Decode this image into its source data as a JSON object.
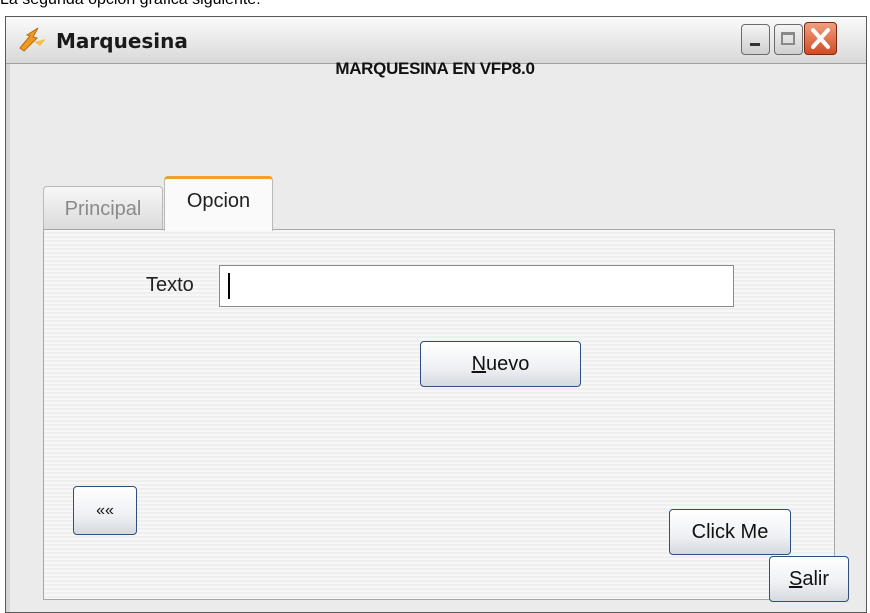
{
  "caption": "La segunda opcion grafica siguiente:",
  "window": {
    "title": "Marquesina",
    "minimize_icon": "minimize-icon",
    "maximize_icon": "maximize-icon",
    "close_icon": "close-icon",
    "app_icon": "lightning-fox-icon"
  },
  "form": {
    "heading": "MARQUESINA EN VFP8.0",
    "tabs": [
      {
        "label": "Principal",
        "active": false
      },
      {
        "label": "Opcion",
        "active": true
      }
    ],
    "texto_label": "Texto",
    "texto_value": "",
    "nuevo_first": "N",
    "nuevo_rest": "uevo",
    "prev_label": "««",
    "click_label": "Click Me",
    "salir_first": "S",
    "salir_rest": "alir"
  },
  "colors": {
    "tab_accent": "#f0a030",
    "close_button": "#d24a22",
    "button_border": "#2f4f7f"
  }
}
